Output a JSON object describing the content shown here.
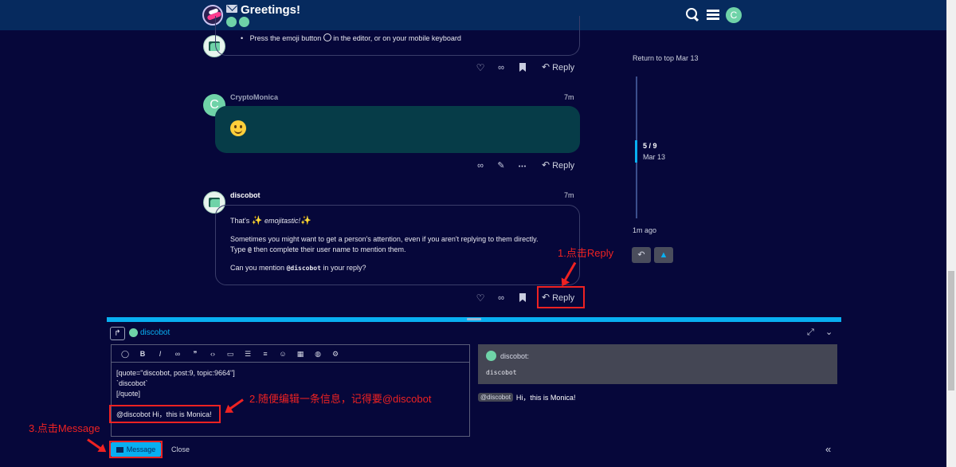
{
  "header": {
    "title": "Greetings!",
    "user_initial": "C"
  },
  "posts": [
    {
      "bullet": "Press the emoji button",
      "bullet_suffix": "in the editor, or on your mobile keyboard",
      "reply_label": "Reply"
    },
    {
      "username": "CryptoMonica",
      "time": "7m",
      "avatar_initial": "C",
      "reply_label": "Reply"
    },
    {
      "username": "discobot",
      "time": "7m",
      "line1_prefix": "That's",
      "line1_em": "emojitastic!",
      "line2": "Sometimes you might want to get a person's attention, even if you aren't replying to them directly.",
      "line3_a": "Type",
      "line3_at": "@",
      "line3_b": "then complete their user name to mention them.",
      "line4_a": "Can you mention",
      "line4_code": "@discobot",
      "line4_b": "in your reply?",
      "reply_label": "Reply"
    }
  ],
  "timeline": {
    "top_link": "Return to top Mar 13",
    "position": "5 / 9",
    "date": "Mar 13",
    "last": "1m ago"
  },
  "composer": {
    "recipient": "discobot",
    "editor_lines": "[quote=\"discobot, post:9, topic:9664\"]\n`discobot`\n[/quote]",
    "editor_message": "@discobot Hi，this is Monica!",
    "preview_quote_author": "discobot:",
    "preview_quote_code": "discobot",
    "preview_mention": "@discobot",
    "preview_text": "Hi，this is Monica!",
    "message_button": "Message",
    "close_button": "Close"
  },
  "annotations": {
    "step1": "1.点击Reply",
    "step2": "2.随便编辑一条信息，记得要@discobot",
    "step3": "3.点击Message"
  },
  "colors": {
    "background": "#06073a",
    "header": "#062a5e",
    "accent": "#08aff1",
    "annotation": "#ee2222"
  }
}
